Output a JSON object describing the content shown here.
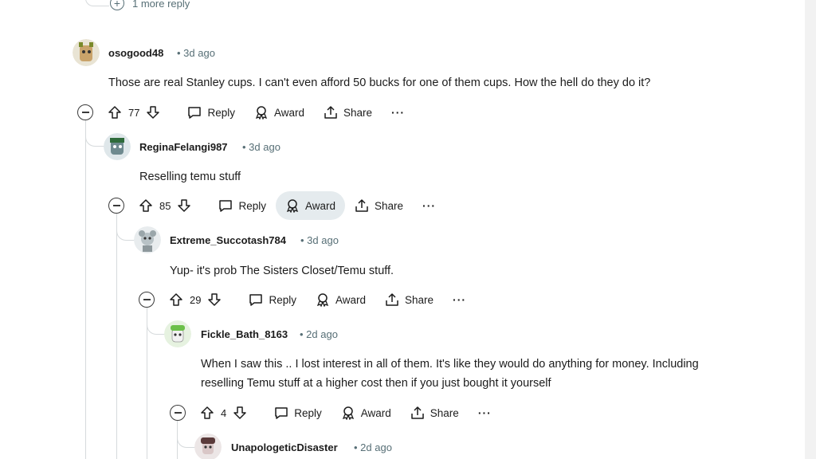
{
  "more_reply": {
    "label": "1 more reply"
  },
  "comments": [
    {
      "author": "osogood48",
      "time": "3d ago",
      "text": "Those are real Stanley cups. I can't even afford 50 bucks for one of them cups. How the hell do they do it?",
      "votes": "77",
      "reply_label": "Reply",
      "award_label": "Award",
      "share_label": "Share",
      "more_label": "···"
    },
    {
      "author": "ReginaFelangi987",
      "time": "3d ago",
      "text": "Reselling temu stuff",
      "votes": "85",
      "reply_label": "Reply",
      "award_label": "Award",
      "share_label": "Share",
      "more_label": "···"
    },
    {
      "author": "Extreme_Succotash784",
      "time": "3d ago",
      "text": "Yup- it's prob The Sisters Closet/Temu stuff.",
      "votes": "29",
      "reply_label": "Reply",
      "award_label": "Award",
      "share_label": "Share",
      "more_label": "···"
    },
    {
      "author": "Fickle_Bath_8163",
      "time": "2d ago",
      "text_line1": "When I saw this .. I lost interest in all of them. It's like they would do anything for money. Including",
      "text_line2": "reselling Temu stuff at a higher cost then if you just bought it yourself",
      "votes": "4",
      "reply_label": "Reply",
      "award_label": "Award",
      "share_label": "Share",
      "more_label": "···"
    },
    {
      "author": "UnapologeticDisaster",
      "time": "2d ago"
    }
  ],
  "icons": {
    "upvote": "arrow-up-outline",
    "downvote": "arrow-down-outline",
    "reply": "speech-bubble",
    "award": "award-ribbon",
    "share": "share-arrow",
    "collapse": "circle-minus",
    "expand": "circle-plus"
  },
  "colors": {
    "meta_text": "#576f76",
    "thread_line": "#d6dadc",
    "hover_bg": "#e5ebee"
  }
}
